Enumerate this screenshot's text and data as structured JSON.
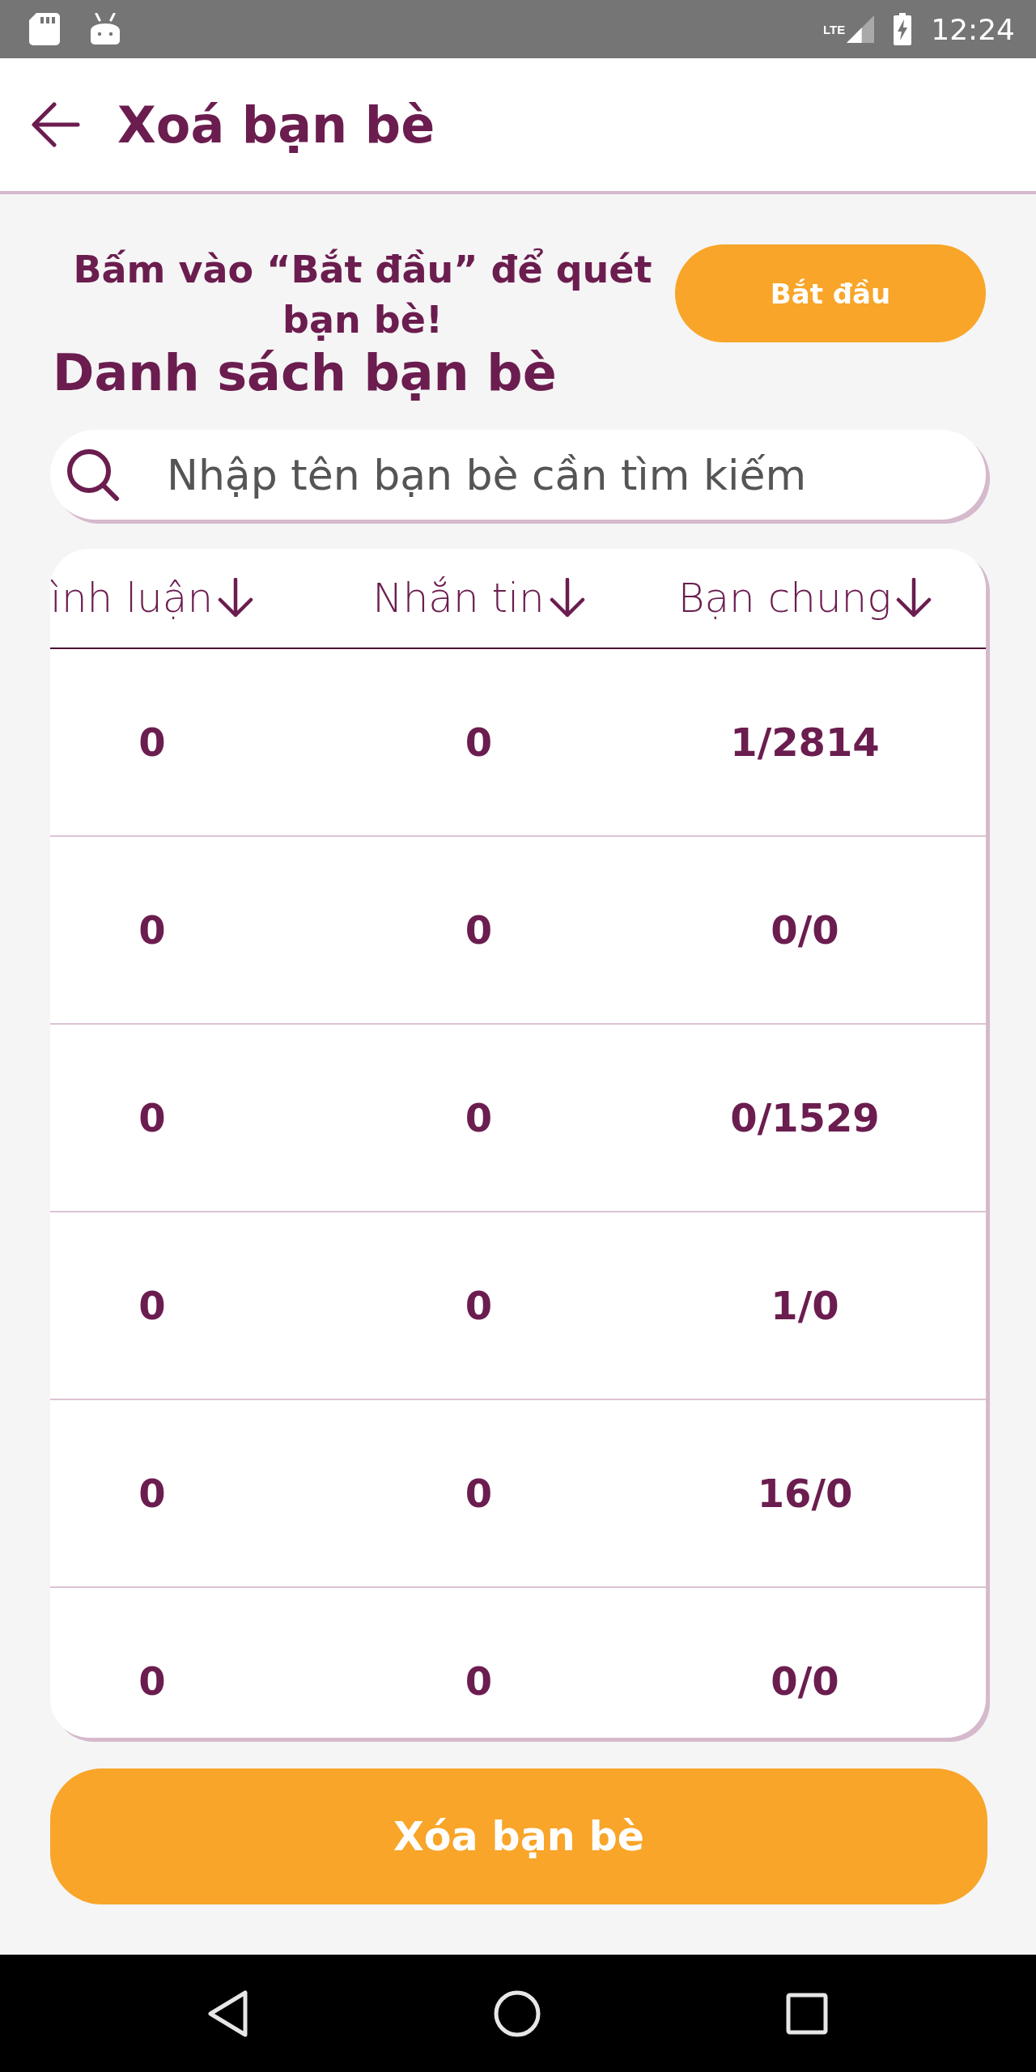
{
  "status_bar": {
    "network": "LTE",
    "time": "12:24"
  },
  "app_bar": {
    "title": "Xoá bạn bè"
  },
  "scan": {
    "instruction": "Bấm vào “Bắt đầu” để quét bạn bè!",
    "button": "Bắt đầu"
  },
  "friend_list": {
    "title": "Danh sách bạn bè",
    "search": {
      "placeholder": "Nhập tên bạn bè cần tìm kiếm"
    },
    "table": {
      "columns": [
        {
          "label": "ình luận"
        },
        {
          "label": "Nhắn tin"
        },
        {
          "label": "Bạn chung"
        }
      ],
      "rows": [
        {
          "cells": [
            "0",
            "0",
            "1/2814"
          ]
        },
        {
          "cells": [
            "0",
            "0",
            "0/0"
          ]
        },
        {
          "cells": [
            "0",
            "0",
            "0/1529"
          ]
        },
        {
          "cells": [
            "0",
            "0",
            "1/0"
          ]
        },
        {
          "cells": [
            "0",
            "0",
            "16/0"
          ]
        },
        {
          "cells": [
            "0",
            "0",
            "0/0"
          ]
        }
      ]
    }
  },
  "delete_button": "Xóa bạn bè"
}
